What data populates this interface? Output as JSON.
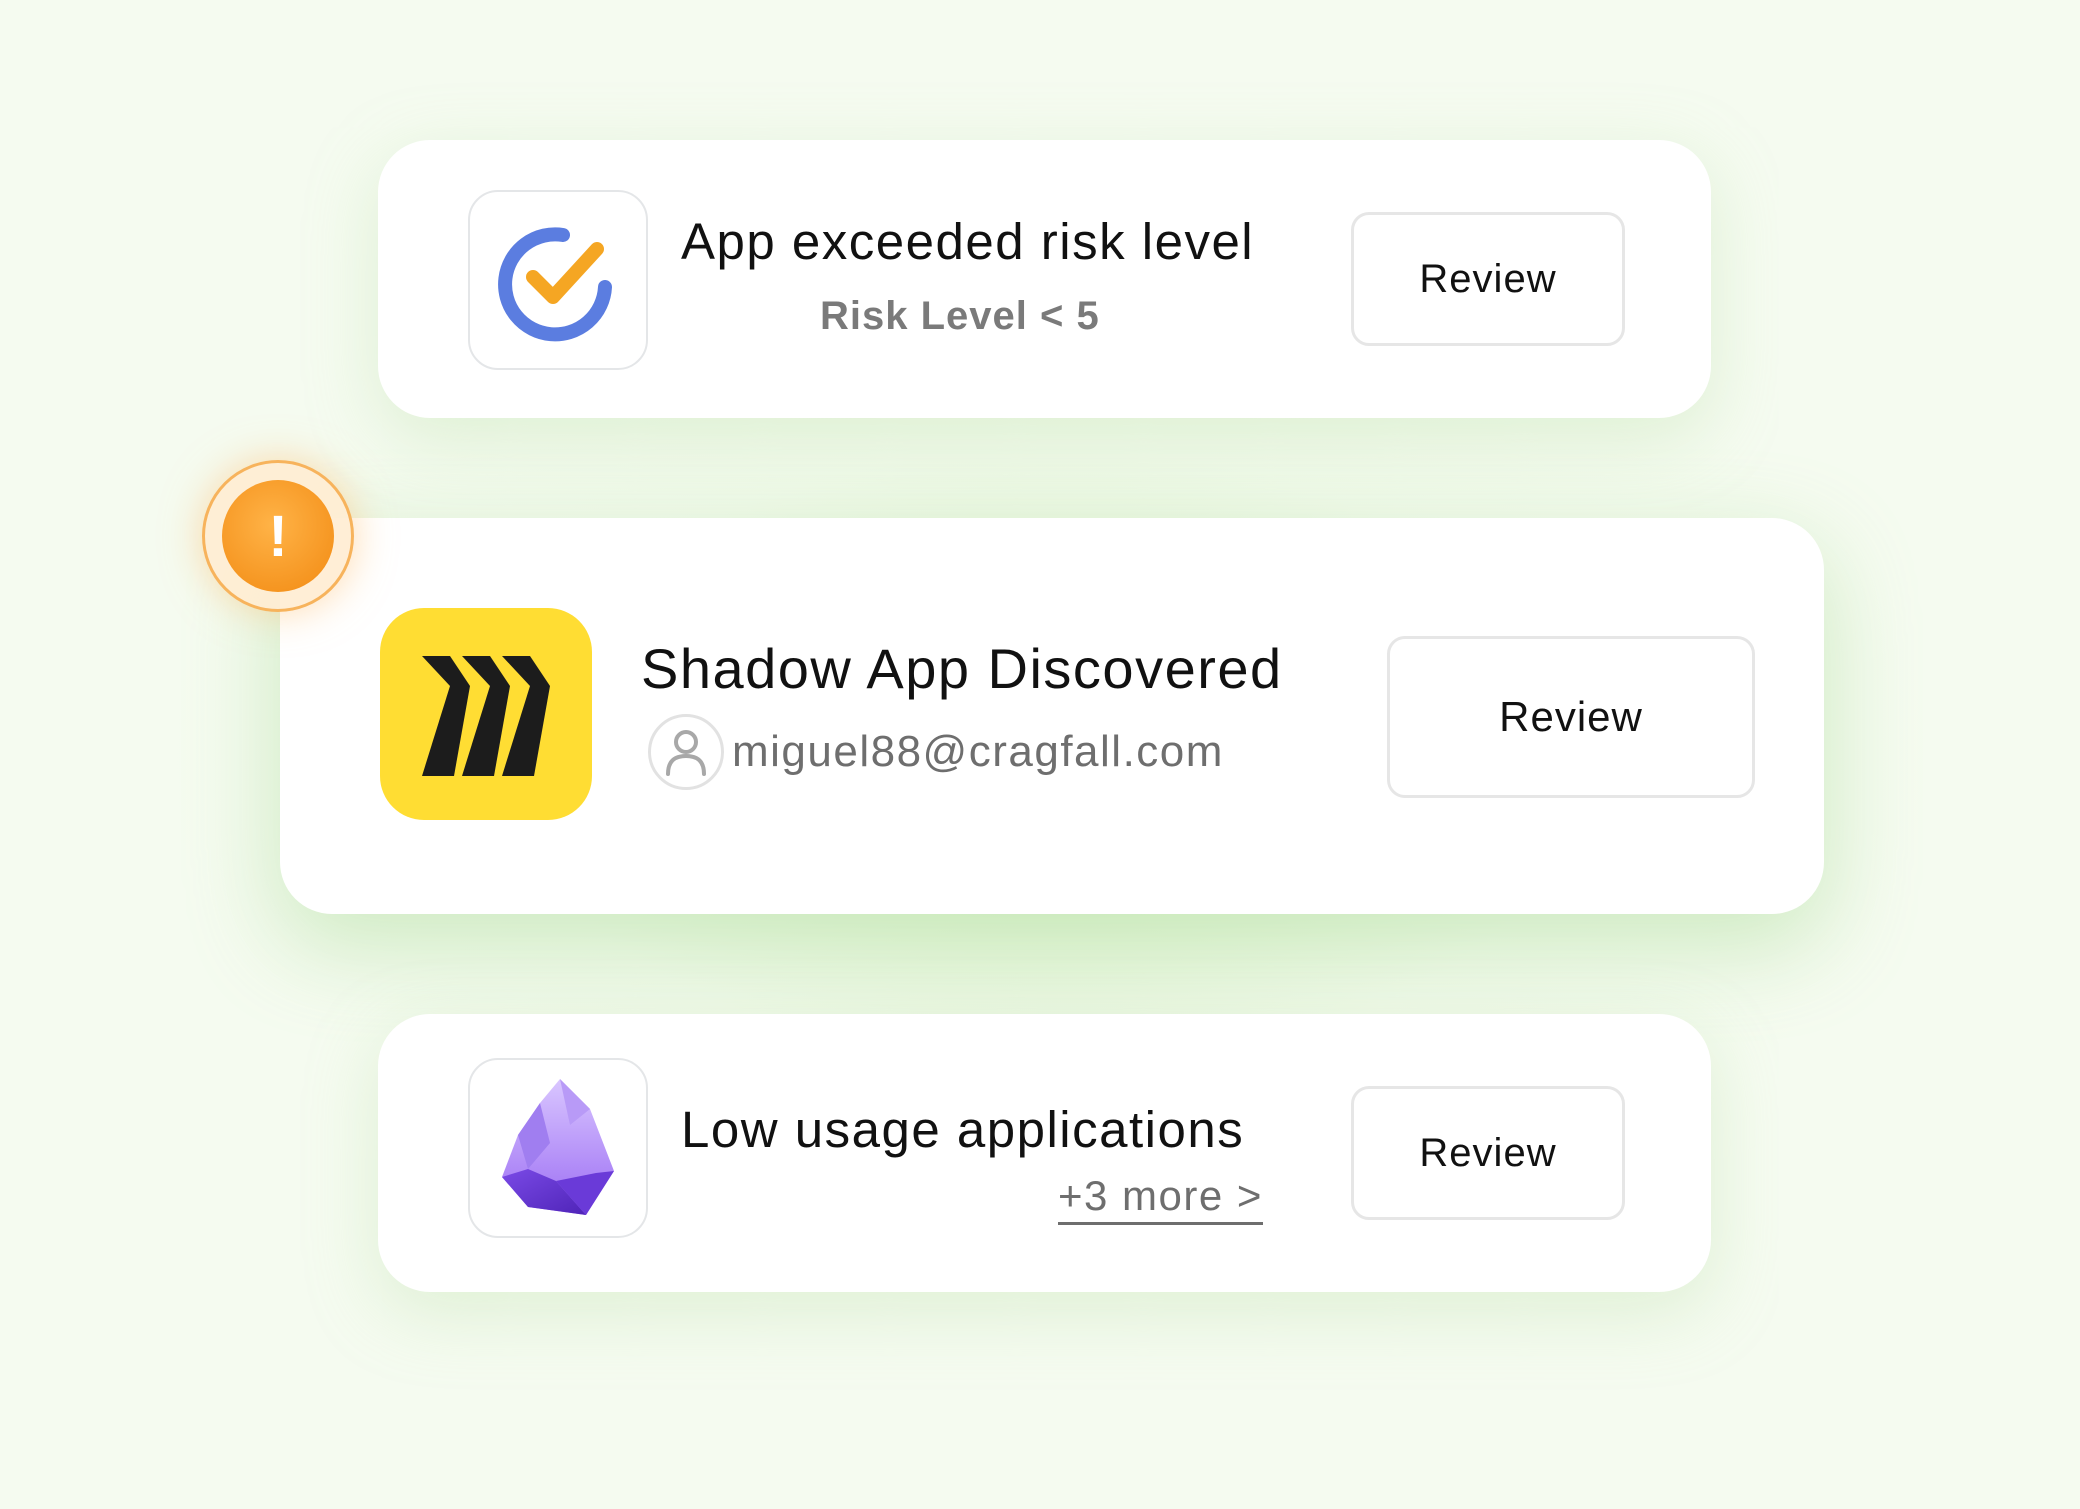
{
  "alerts": [
    {
      "title": "App exceeded risk level",
      "subtitle": "Risk Level < 5",
      "button_label": "Review",
      "icon": "ticktick-checkmark-icon",
      "colors": {
        "ring": "#5b7de0",
        "check": "#f5a623"
      }
    },
    {
      "title": "Shadow App Discovered",
      "user_email": "miguel88@cragfall.com",
      "button_label": "Review",
      "icon": "miro-logo-icon",
      "badge_symbol": "!",
      "colors": {
        "logo_bg": "#ffdd33",
        "badge": "#f5941f"
      }
    },
    {
      "title": "Low usage applications",
      "more_link": "+3 more >",
      "button_label": "Review",
      "icon": "obsidian-crystal-icon",
      "colors": {
        "crystal": "#8a5cf5"
      }
    }
  ]
}
